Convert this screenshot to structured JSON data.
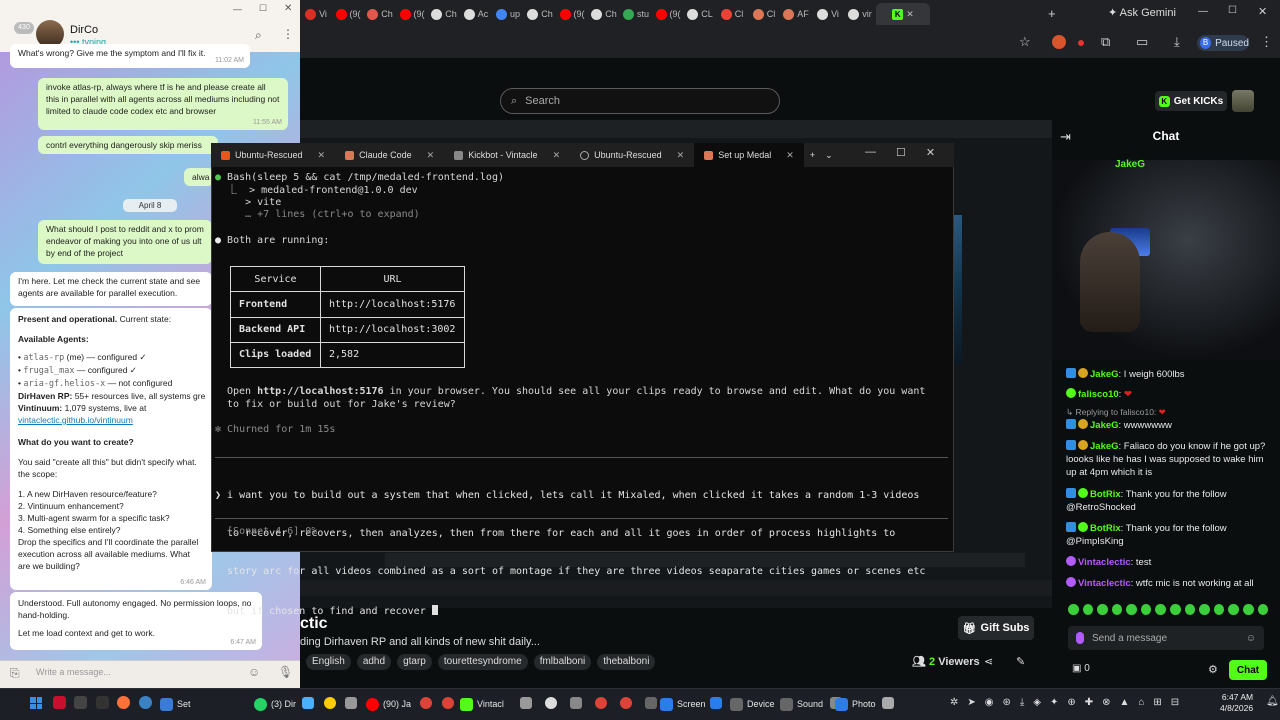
{
  "browser": {
    "tabs": [
      {
        "label": "Vi",
        "color": "#d93025"
      },
      {
        "label": "(9(",
        "color": "#ff0000"
      },
      {
        "label": "Ch",
        "color": "#e2574c"
      },
      {
        "label": "(9(",
        "color": "#ff0000"
      },
      {
        "label": "Ch",
        "color": "#dddddd"
      },
      {
        "label": "Ac",
        "color": "#dddddd"
      },
      {
        "label": "up",
        "color": "#4285f4"
      },
      {
        "label": "Ch",
        "color": "#dddddd"
      },
      {
        "label": "(9(",
        "color": "#ff0000"
      },
      {
        "label": "Ch",
        "color": "#dddddd"
      },
      {
        "label": "stu",
        "color": "#34a853"
      },
      {
        "label": "(9(",
        "color": "#ff0000"
      },
      {
        "label": "CL",
        "color": "#dddddd"
      },
      {
        "label": "Cl",
        "color": "#ea4335"
      },
      {
        "label": "Cl",
        "color": "#d97757"
      },
      {
        "label": "AF",
        "color": "#d97757"
      },
      {
        "label": "Vi",
        "color": "#dddddd"
      },
      {
        "label": "vir",
        "color": "#dddddd"
      }
    ],
    "active_tab_icon": "K",
    "ask_gemini": "Ask Gemini",
    "profile_initial": "B",
    "paused_label": "Paused"
  },
  "kick": {
    "search_placeholder": "Search",
    "get_kicks": "Get KICKs",
    "chat_title": "Chat",
    "top_user": "JakeG",
    "channel_title": "ctic",
    "channel_subtitle": "ding Dirhaven RP and all kinds of new shit daily...",
    "tags": [
      "English",
      "adhd",
      "gtarp",
      "tourettesyndrome",
      "fmlbalboni",
      "thebalboni"
    ],
    "gift_subs": "Gift Subs",
    "viewers_count": "2",
    "viewers_label": "Viewers",
    "send_placeholder": "Send a message",
    "points": "0",
    "chat_button": "Chat",
    "accent": "#53fc18",
    "messages": [
      {
        "user": "JakeG",
        "text": ": I weigh 600lbs",
        "color": "#53fc18"
      },
      {
        "user": "falisco10",
        "text": ":",
        "color": "#53fc18",
        "extra": "heart"
      },
      {
        "reply": "Replying to falisco10:"
      },
      {
        "user": "JakeG",
        "text": ": wwwwwww",
        "color": "#53fc18"
      },
      {
        "user": "JakeG",
        "text": ": Faliaco do you know if he got up? loooks like he has I was supposed to wake him up at 4pm which it is",
        "color": "#53fc18"
      },
      {
        "user": "BotRix",
        "text": ": Thank you for the follow @RetroShocked",
        "color": "#53fc18"
      },
      {
        "user": "BotRix",
        "text": ": Thank you for the follow @PimpIsKing",
        "color": "#53fc18"
      },
      {
        "user": "Vintaclectic",
        "text": ": test",
        "color": "#b25bff"
      },
      {
        "user": "Vintaclectic",
        "text": ": wtfc mic is not working at all",
        "color": "#b25bff"
      }
    ]
  },
  "whatsapp": {
    "contact": "DirCo",
    "status": "typing",
    "unread": "430",
    "date_chip": "April 8",
    "input_placeholder": "Write a message...",
    "bubbles": [
      {
        "text": "What's wrong? Give me the symptom and I'll fix it.",
        "time": "11:02 AM",
        "out": false
      },
      {
        "text": "invoke atlas-rp, always where tf is he and please create all this in parallel with all agents across all mediums including not limited to claude code codex etc and browser",
        "time": "11:55 AM",
        "out": true
      },
      {
        "text": "contrl everything dangerously skip meriss",
        "time": "",
        "out": true
      },
      {
        "text": "alwa",
        "time": "",
        "out": true
      },
      {
        "text": "What should I post to reddit and x to prom endeavor of making you into one of us ult by end of the project",
        "time": "",
        "out": true
      },
      {
        "text": "I'm here. Let me check the current state and see agents are available for parallel execution.",
        "time": "",
        "out": false
      }
    ],
    "long_reply": {
      "heading": "Present and operational.",
      "heading_rest": " Current state:",
      "agents_title": "Available Agents:",
      "agents": [
        {
          "name": "atlas-rp",
          "rest": " (me) — configured ✓"
        },
        {
          "name": "frugal_max",
          "rest": " — configured ✓"
        },
        {
          "name": "aria-gf.helios-x",
          "rest": " — not configured"
        }
      ],
      "dirhaven": "DirHaven RP:",
      "dirhaven_rest": " 55+ resources live, all systems gre",
      "vintinuum": "Vintinuum:",
      "vintinuum_rest": " 1,079 systems, live at",
      "link": "vintaclectic.github.io/vintinuum",
      "question": "What do you want to create?",
      "p1": "You said \"create all this\" but didn't specify what. the scope:",
      "options": [
        "1. A new DirHaven resource/feature?",
        "2. Vintinuum enhancement?",
        "3. Multi-agent swarm for a specific task?",
        "4. Something else entirely?"
      ],
      "p2": "Drop the specifics and I'll coordinate the parallel execution across all available mediums. What are we building?",
      "time": "6:46 AM"
    },
    "last": {
      "line1": "Understood. Full autonomy engaged. No permission loops, no hand-holding.",
      "line2": "Let me load context and get to work.",
      "time": "6:47 AM"
    }
  },
  "terminal": {
    "tabs": [
      {
        "label": "Ubuntu-Rescued",
        "icon": "#e95420",
        "active": false
      },
      {
        "label": "Claude Code",
        "icon": "#d97757",
        "active": false
      },
      {
        "label": "Kickbot - Vintacle",
        "icon": "#888888",
        "active": false
      },
      {
        "label": "Ubuntu-Rescued",
        "icon": "#e95420",
        "active": false
      },
      {
        "label": "Set up Medal",
        "icon": "#d97757",
        "active": true
      }
    ],
    "lines": {
      "l1_bullet": "●",
      "l1": " Bash(sleep 5 && cat /tmp/medaled-frontend.log)",
      "l2": "  ⎿  > medaled-frontend@1.0.0 dev",
      "l3": "     > vite",
      "l4": "     … +7 lines (ctrl+o to expand)",
      "l5_bullet": "●",
      "l5": " Both are running:",
      "open_pre": "Open ",
      "open_url": "http://localhost:5176",
      "open_post": " in your browser. You should see all your clips ready to browse and edit. What do you want",
      "open_l2": "to fix or build out for Jake's review?",
      "churned": "✻ Churned for 1m 15s",
      "prompt_char": "❯",
      "prompt_l1": " i want you to build out a system that when clicked, lets call it Mixaled, when clicked it takes a random 1-3 videos",
      "prompt_l2": "  to recover, recovers, then analyzes, then from there for each and all it goes in order of process highlights to",
      "prompt_l3": "  story arc for all videos combined as a sort of montage if they are three videos seaparate cities games or scenes etc",
      "prompt_l4": "  but if chosen to find and recover ",
      "status": "  [Sonnet 4.6] 0%"
    },
    "table": {
      "headers": [
        "Service",
        "URL"
      ],
      "rows": [
        [
          "Frontend",
          "http://localhost:5176"
        ],
        [
          "Backend API",
          "http://localhost:3002"
        ],
        [
          "Clips loaded",
          "2,582"
        ]
      ]
    }
  },
  "taskbar": {
    "items": [
      {
        "label": "Set",
        "color": "#3a7bd5"
      },
      {
        "label": "(3) Dir",
        "color": "#25d366"
      },
      {
        "label": "(90) Ja",
        "color": "#ff0000"
      },
      {
        "label": "Vintacl",
        "color": "#53fc18"
      },
      {
        "label": "Screen",
        "color": "#2b7de9"
      },
      {
        "label": "Device",
        "color": "#666666"
      },
      {
        "label": "Sound",
        "color": "#666666"
      },
      {
        "label": "Photo",
        "color": "#2b7de9"
      }
    ],
    "time": "6:47 AM",
    "date": "4/8/2026"
  }
}
